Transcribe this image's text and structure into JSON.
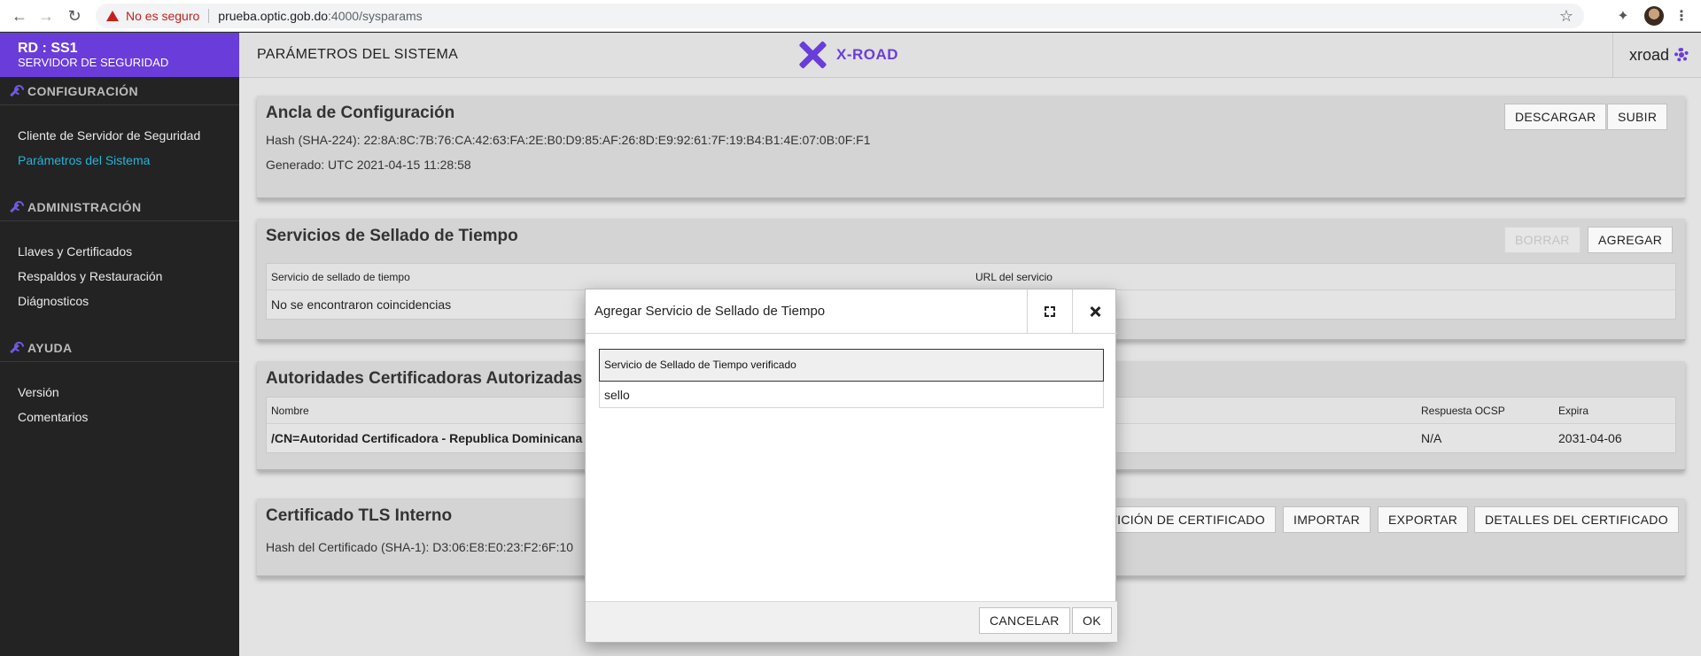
{
  "browser": {
    "security_warning": "No es seguro",
    "url_host": "prueba.optic.gob.do",
    "url_rest": ":4000/sysparams"
  },
  "sidebar": {
    "brand_title": "RD : SS1",
    "brand_subtitle": "SERVIDOR DE SEGURIDAD",
    "sections": [
      {
        "title": "CONFIGURACIÓN",
        "items": [
          "Cliente de Servidor de Seguridad",
          "Parámetros del Sistema"
        ]
      },
      {
        "title": "ADMINISTRACIÓN",
        "items": [
          "Llaves y Certificados",
          "Respaldos y Restauración",
          "Diágnosticos"
        ]
      },
      {
        "title": "AYUDA",
        "items": [
          "Versión",
          "Comentarios"
        ]
      }
    ]
  },
  "header": {
    "page_title": "PARÁMETROS DEL SISTEMA",
    "logo_text": "X-ROAD",
    "user": "xroad"
  },
  "anchor": {
    "title": "Ancla de Configuración",
    "hash": "Hash (SHA-224): 22:8A:8C:7B:76:CA:42:63:FA:2E:B0:D9:85:AF:26:8D:E9:92:61:7F:19:B4:B1:4E:07:0B:0F:F1",
    "generated": "Generado: UTC 2021-04-15 11:28:58",
    "download_label": "DESCARGAR",
    "upload_label": "SUBIR"
  },
  "tsp": {
    "title": "Servicios de Sellado de Tiempo",
    "delete_label": "BORRAR",
    "add_label": "AGREGAR",
    "col_service": "Servicio de sellado de tiempo",
    "col_url": "URL del servicio",
    "empty": "No se encontraron coincidencias"
  },
  "ca": {
    "title": "Autoridades Certificadoras Autorizadas",
    "col_name": "Nombre",
    "col_ocsp": "Respuesta OCSP",
    "col_expires": "Expira",
    "rows": [
      {
        "name": "/CN=Autoridad Certificadora - Republica Dominicana",
        "ocsp": "N/A",
        "expires": "2031-04-06"
      }
    ]
  },
  "tls": {
    "title": "Certificado TLS Interno",
    "hash": "Hash del Certificado (SHA-1): D3:06:E8:E0:23:F2:6F:10",
    "csr_label": "PETICIÓN DE CERTIFICADO",
    "import_label": "IMPORTAR",
    "export_label": "EXPORTAR",
    "details_label": "DETALLES DEL CERTIFICADO"
  },
  "dialog": {
    "title": "Agregar Servicio de Sellado de Tiempo",
    "list_header": "Servicio de Sellado de Tiempo verificado",
    "list_items": [
      "sello"
    ],
    "cancel_label": "CANCELAR",
    "ok_label": "OK"
  },
  "colors": {
    "brand_purple": "#6a3ddb",
    "active_link": "#27b3d7",
    "sidebar_bg": "#232323"
  }
}
